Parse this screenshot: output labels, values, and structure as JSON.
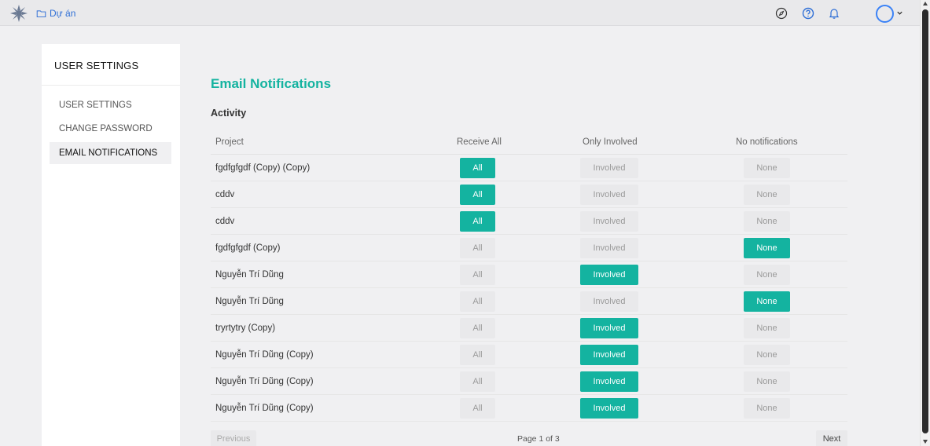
{
  "topbar": {
    "breadcrumb_label": "Dự án"
  },
  "sidebar": {
    "title": "USER SETTINGS",
    "items": [
      {
        "label": "USER SETTINGS"
      },
      {
        "label": "CHANGE PASSWORD"
      },
      {
        "label": "EMAIL NOTIFICATIONS"
      }
    ]
  },
  "main": {
    "title": "Email Notifications",
    "section": "Activity",
    "columns": {
      "project": "Project",
      "receive_all": "Receive All",
      "only_involved": "Only Involved",
      "no_notifications": "No notifications"
    },
    "button_labels": {
      "all": "All",
      "involved": "Involved",
      "none": "None"
    },
    "rows": [
      {
        "project": "fgdfgfgdf (Copy) (Copy)",
        "selected": "all"
      },
      {
        "project": "cddv",
        "selected": "all"
      },
      {
        "project": "cddv",
        "selected": "all"
      },
      {
        "project": "fgdfgfgdf (Copy)",
        "selected": "none"
      },
      {
        "project": "Nguyễn Trí Dũng",
        "selected": "involved"
      },
      {
        "project": "Nguyễn Trí Dũng",
        "selected": "none"
      },
      {
        "project": "tryrtytry (Copy)",
        "selected": "involved"
      },
      {
        "project": "Nguyễn Trí Dũng (Copy)",
        "selected": "involved"
      },
      {
        "project": "Nguyễn Trí Dũng (Copy)",
        "selected": "involved"
      },
      {
        "project": "Nguyễn Trí Dũng (Copy)",
        "selected": "involved"
      }
    ],
    "pager": {
      "prev": "Previous",
      "info": "Page 1 of 3",
      "next": "Next"
    }
  },
  "colors": {
    "accent": "#14b3a0",
    "link": "#2f6fd6"
  }
}
